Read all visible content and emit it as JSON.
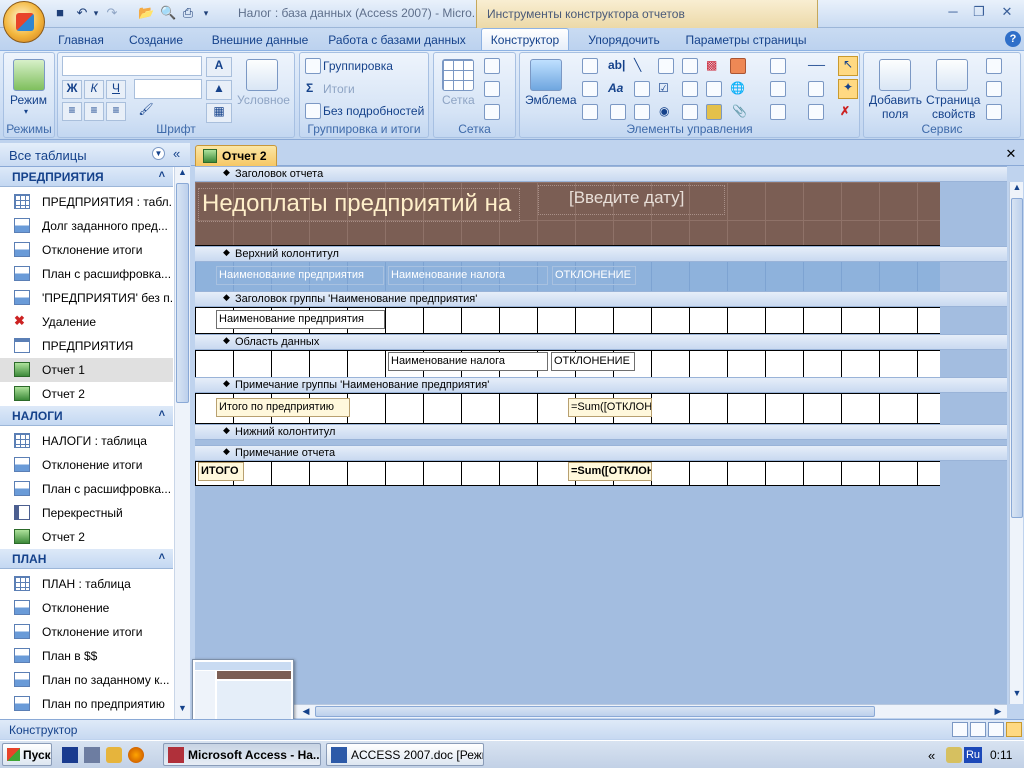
{
  "window": {
    "title": "Налог : база данных (Access 2007) - Micro...",
    "context_tools": "Инструменты конструктора отчетов"
  },
  "tabs": [
    "Главная",
    "Создание",
    "Внешние данные",
    "Работа с базами данных",
    "Конструктор",
    "Упорядочить",
    "Параметры страницы"
  ],
  "ribbon": {
    "modes": {
      "view": "Режим",
      "caption": "Режимы"
    },
    "font": {
      "bold": "Ж",
      "italic": "К",
      "underline": "Ч",
      "conditional": "Условное",
      "caption": "Шрифт"
    },
    "grouping": {
      "group": "Группировка",
      "totals": "Итоги",
      "hide_details": "Без подробностей",
      "caption": "Группировка и итоги"
    },
    "grid": {
      "grid": "Сетка",
      "caption": "Сетка"
    },
    "controls": {
      "logo": "Эмблема",
      "caption": "Элементы управления"
    },
    "tools": {
      "add_fields": "Добавить\nполя",
      "add_fields_1": "Добавить",
      "add_fields_2": "поля",
      "props_1": "Страница",
      "props_2": "свойств",
      "caption": "Сервис"
    }
  },
  "nav": {
    "header": "Все таблицы",
    "sections": [
      {
        "title": "ПРЕДПРИЯТИЯ",
        "items": [
          {
            "label": "ПРЕДПРИЯТИЯ : табл...",
            "icon": "table"
          },
          {
            "label": "Долг заданного пред...",
            "icon": "query"
          },
          {
            "label": "Отклонение итоги",
            "icon": "query"
          },
          {
            "label": "План с расшифровка...",
            "icon": "query"
          },
          {
            "label": "'ПРЕДПРИЯТИЯ' без п...",
            "icon": "query"
          },
          {
            "label": "Удаление",
            "icon": "delete-query"
          },
          {
            "label": "ПРЕДПРИЯТИЯ",
            "icon": "form"
          },
          {
            "label": "Отчет 1",
            "icon": "report",
            "selected": true
          },
          {
            "label": "Отчет 2",
            "icon": "report"
          }
        ]
      },
      {
        "title": "НАЛОГИ",
        "items": [
          {
            "label": "НАЛОГИ : таблица",
            "icon": "table"
          },
          {
            "label": "Отклонение итоги",
            "icon": "query"
          },
          {
            "label": "План с расшифровка...",
            "icon": "query"
          },
          {
            "label": "Перекрестный",
            "icon": "crosstab"
          },
          {
            "label": "Отчет 2",
            "icon": "report"
          }
        ]
      },
      {
        "title": "ПЛАН",
        "items": [
          {
            "label": "ПЛАН : таблица",
            "icon": "table"
          },
          {
            "label": "Отклонение",
            "icon": "query"
          },
          {
            "label": "Отклонение итоги",
            "icon": "query"
          },
          {
            "label": "План в $$",
            "icon": "query"
          },
          {
            "label": "План по заданному к...",
            "icon": "query"
          },
          {
            "label": "План по предприятию",
            "icon": "query"
          },
          {
            "label": "План с расшифровка...",
            "icon": "query"
          }
        ]
      }
    ]
  },
  "document": {
    "tab": "Отчет 2",
    "sections": {
      "report_header": "Заголовок отчета",
      "page_header": "Верхний колонтитул",
      "group_header": "Заголовок группы 'Наименование предприятия'",
      "detail": "Область данных",
      "group_footer": "Примечание группы 'Наименование предприятия'",
      "page_footer": "Нижний колонтитул",
      "report_footer": "Примечание отчета"
    },
    "controls": {
      "title": "Недоплаты предприятий на",
      "date": "[Введите дату]",
      "ph_company": "Наименование предприятия",
      "ph_tax": "Наименование налога",
      "ph_dev": "ОТКЛОНЕНИЕ",
      "gh_company": "Наименование предприятия",
      "d_tax": "Наименование налога",
      "d_dev": "ОТКЛОНЕНИЕ",
      "gf_label": "Итого по предприятию",
      "gf_sum": "=Sum([ОТКЛОН",
      "rf_label": "ИТОГО",
      "rf_sum": "=Sum([ОТКЛОН"
    }
  },
  "status": {
    "text": "Конструктор"
  },
  "taskbar": {
    "start": "Пуск",
    "tasks": [
      "Microsoft Access - На...",
      "ACCESS 2007.doc [Режи..."
    ],
    "lang": "Ru",
    "clock": "0:11"
  }
}
